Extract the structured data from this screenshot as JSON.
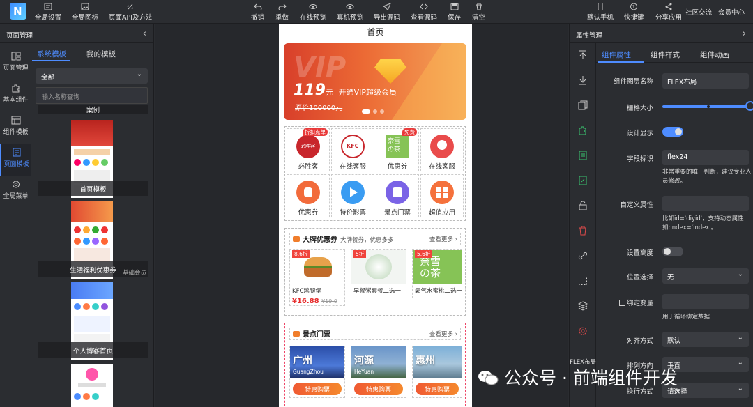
{
  "toolbar": {
    "left": [
      {
        "label": "全局设置",
        "icon": "settings-icon"
      },
      {
        "label": "全局图标",
        "icon": "image-icon"
      },
      {
        "label": "页面API及方法",
        "icon": "link-icon"
      }
    ],
    "center": [
      {
        "label": "撤销",
        "icon": "undo-icon"
      },
      {
        "label": "重做",
        "icon": "redo-icon"
      },
      {
        "label": "在线预览",
        "icon": "eye-icon"
      },
      {
        "label": "真机预览",
        "icon": "eye-icon"
      },
      {
        "label": "导出源码",
        "icon": "send-icon"
      },
      {
        "label": "查看源码",
        "icon": "code-icon"
      },
      {
        "label": "保存",
        "icon": "save-icon"
      },
      {
        "label": "清空",
        "icon": "trash-icon"
      }
    ],
    "right": [
      {
        "label": "默认手机",
        "icon": "phone-icon"
      },
      {
        "label": "快捷键",
        "icon": "help-icon"
      },
      {
        "label": "分享应用",
        "icon": "share-icon"
      },
      {
        "label": "社区交流"
      },
      {
        "label": "会员中心"
      }
    ]
  },
  "left_panel": {
    "title": "页面管理",
    "nav": [
      {
        "label": "页面管理"
      },
      {
        "label": "基本组件"
      },
      {
        "label": "组件模板"
      },
      {
        "label": "页面模板"
      },
      {
        "label": "全局菜单"
      }
    ],
    "tabs": [
      "系统模板",
      "我的模板"
    ],
    "category_select": "全部",
    "search_placeholder": "输入名称查询",
    "templates": [
      {
        "name": "案例"
      },
      {
        "name": "首页模板"
      },
      {
        "name": "生活福利优惠券",
        "tag": "基础会员"
      },
      {
        "name": "个人博客首页"
      }
    ]
  },
  "phone": {
    "page_title": "首页",
    "vip_banner": {
      "watermark": "VIP",
      "price": "119",
      "unit": "元",
      "headline": "开通VIP超级会员",
      "original_price": "原价100000元"
    },
    "icon_grid": [
      {
        "label": "必胜客",
        "badge": "折扣点单",
        "color": "#c8262c"
      },
      {
        "label": "在线客服",
        "color": "#ffffff"
      },
      {
        "label": "优惠券",
        "badge": "免费",
        "color": "#86c356"
      },
      {
        "label": "在线客服",
        "color": "#e94b4b"
      },
      {
        "label": "优惠券",
        "color": "#f26b3b"
      },
      {
        "label": "特价影票",
        "color": "#3a9cf2"
      },
      {
        "label": "景点门票",
        "color": "#7a63e6"
      },
      {
        "label": "超值应用",
        "color": "#f5713c"
      }
    ],
    "coupons": {
      "title": "大牌优惠券",
      "subtitle": "大牌餐券，优惠多多",
      "more": "查看更多",
      "items": [
        {
          "discount": "8.6折",
          "name": "KFC鸡腿堡",
          "price": "¥16.88",
          "original": "¥19.9"
        },
        {
          "discount": "5折",
          "name": "早餐粥套餐二选一"
        },
        {
          "discount": "5.6折",
          "name": "霸气水蜜桃二选一"
        }
      ]
    },
    "tickets": {
      "title": "景点门票",
      "more": "查看更多",
      "items": [
        {
          "city": "广州",
          "pinyin": "GuangZhou",
          "button": "特惠购票"
        },
        {
          "city": "河源",
          "pinyin": "HeYuan",
          "button": "特惠购票"
        },
        {
          "city": "惠州",
          "pinyin": "",
          "button": "特惠购票"
        }
      ]
    }
  },
  "right_panel": {
    "title": "属性管理",
    "flex_label": "FLEX布局",
    "tabs": [
      "组件属性",
      "组件样式",
      "组件动画"
    ],
    "props": {
      "layer_name_label": "组件图层名称",
      "layer_name": "FLEX布局",
      "grid_size_label": "栅格大小",
      "grid_size": 1,
      "display_label": "设计显示",
      "display": true,
      "field_label": "字段标识",
      "field_value": "flex24",
      "field_hint": "非常重要的唯一判断，建议专业人员修改。",
      "custom_attr_label": "自定义属性",
      "custom_attr_value": "",
      "custom_attr_hint": "比如id='diyid'，支持动态属性如:index='index'。",
      "height_label": "设置高度",
      "height_enabled": false,
      "position_label": "位置选择",
      "position_value": "无",
      "bind_label": "绑定变量",
      "bind_value": "",
      "bind_hint": "用于循环绑定数据",
      "align_label": "对齐方式",
      "align_value": "默认",
      "direction_label": "排列方向",
      "direction_value": "垂直",
      "wrap_label": "换行方式",
      "wrap_value": "请选择"
    }
  },
  "watermark": "公众号 · 前端组件开发",
  "colors": {
    "accent": "#4e8cff",
    "bg": "#2b2d31",
    "canvas": "#26282c"
  }
}
